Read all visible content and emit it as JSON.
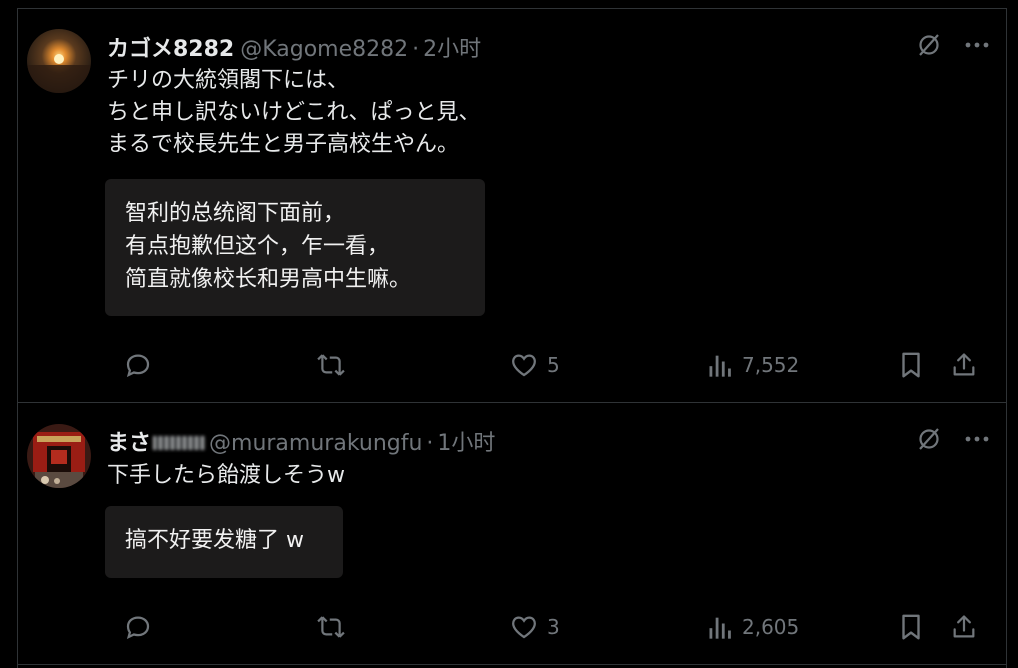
{
  "tweets": [
    {
      "name": "カゴメ8282",
      "handle": "@Kagome8282",
      "separator": "·",
      "time": "2小时",
      "text_lines": [
        "チリの大統領閣下には、",
        "ちと申し訳ないけどこれ、ぱっと見、",
        "まるで校長先生と男子高校生やん。"
      ],
      "translation_lines": [
        "智利的总统阁下面前，",
        "有点抱歉但这个，乍一看，",
        "简直就像校长和男高中生嘛。"
      ],
      "likes": "5",
      "views": "7,552",
      "retweets": "",
      "replies": ""
    },
    {
      "name": "まさ",
      "handle": "@muramurakungfu",
      "separator": "·",
      "time": "1小时",
      "text_lines": [
        "下手したら飴渡しそうw"
      ],
      "translation_lines": [
        "搞不好要发糖了 w"
      ],
      "likes": "3",
      "views": "2,605",
      "retweets": "",
      "replies": ""
    }
  ],
  "icons": {
    "grok": "grok-slash-icon",
    "more": "more-dots-icon",
    "reply": "reply-bubble-icon",
    "retweet": "retweet-icon",
    "like": "heart-icon",
    "views": "views-bars-icon",
    "bookmark": "bookmark-icon",
    "share": "share-icon"
  },
  "colors": {
    "background": "#000000",
    "text": "#e7e9ea",
    "muted": "#71767b",
    "border": "#2f3336",
    "translation_box": "#1c1b1b"
  }
}
